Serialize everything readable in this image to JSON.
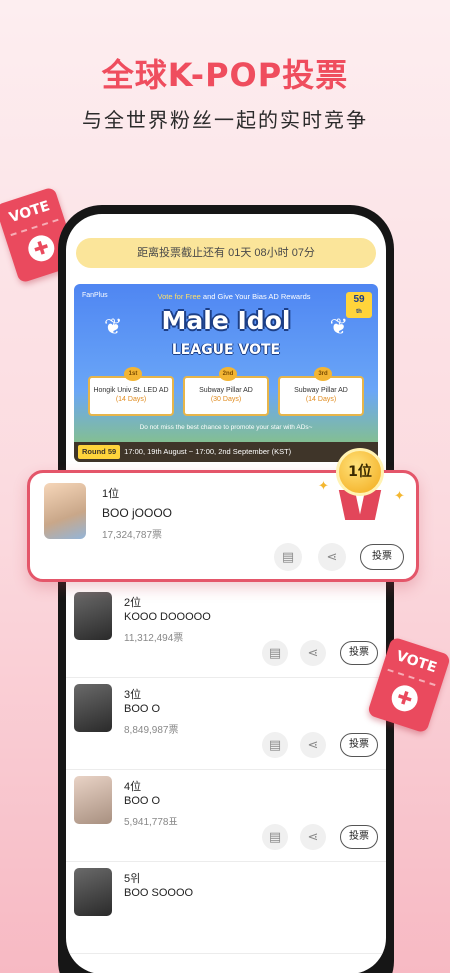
{
  "headline": "全球K-POP投票",
  "subline": "与全世界粉丝一起的实时竞争",
  "ticket_label": "VOTE",
  "deadline": "距离投票截止还有 01天 08小时 07分",
  "banner": {
    "brand": "FanPlus",
    "top_text_a": "Vote for Free",
    "top_text_b": " and Give Your Bias AD Rewards",
    "round_badge": "59",
    "round_badge_suffix": "th",
    "title": "Male Idol",
    "subtitle": "LEAGUE VOTE",
    "prizes": [
      {
        "place": "1st",
        "label": "Hongik Univ St. LED AD",
        "days": "(14 Days)"
      },
      {
        "place": "2nd",
        "label": "Subway Pillar AD",
        "days": "(30 Days)"
      },
      {
        "place": "3rd",
        "label": "Subway Pillar AD",
        "days": "(14 Days)"
      }
    ],
    "note": "Do not miss the best chance to promote your star with ADs~",
    "round_label": "Round 59",
    "period": "17:00, 19th August ~ 17:00, 2nd September (KST)"
  },
  "award_badge": "1位",
  "vote_button_label": "投票",
  "highlight": {
    "rank": "1位",
    "name": "BOO jOOOO",
    "votes": "17,324,787票"
  },
  "items": [
    {
      "rank": "2位",
      "name": "KOOO DOOOOO",
      "votes": "11,312,494票"
    },
    {
      "rank": "3位",
      "name": "BOO O",
      "votes": "8,849,987票"
    },
    {
      "rank": "4位",
      "name": "BOO O",
      "votes": "5,941,778표"
    },
    {
      "rank": "5위",
      "name": "BOO SOOOO",
      "votes": ""
    }
  ],
  "colors": {
    "accent": "#ef4d5e",
    "card_border": "#e4566a",
    "deadline_bg": "#fbe59a"
  }
}
